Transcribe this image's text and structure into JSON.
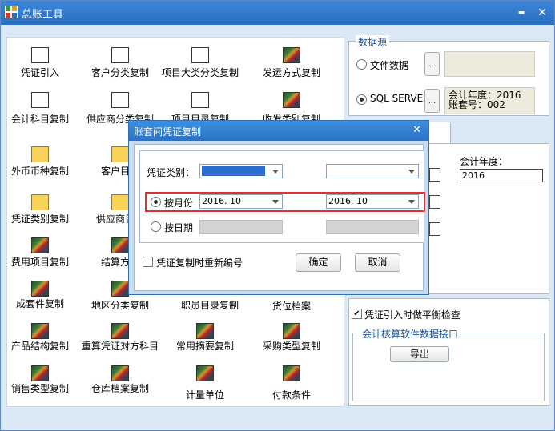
{
  "window": {
    "title": "总账工具",
    "min_glyph": "▬",
    "close_glyph": "✕"
  },
  "tools": [
    {
      "label": "凭证引入",
      "icon": "doc-icon"
    },
    {
      "label": "客户分类复制",
      "icon": "doc-icon"
    },
    {
      "label": "项目大类分类复制",
      "icon": "doc-icon"
    },
    {
      "label": "发运方式复制",
      "icon": "image-icon"
    },
    {
      "label": "会计科目复制",
      "icon": "doc-icon"
    },
    {
      "label": "供应商分类复制",
      "icon": "doc-icon"
    },
    {
      "label": "项目目录复制",
      "icon": "menu-icon"
    },
    {
      "label": "收发类别复制",
      "icon": "image-icon"
    },
    {
      "label": "外币币种复制",
      "icon": "folder-icon"
    },
    {
      "label": "客户目录",
      "icon": "folder-icon"
    },
    {
      "label": "凭证类别复制",
      "icon": "folder-icon"
    },
    {
      "label": "供应商目录",
      "icon": "folder-icon"
    },
    {
      "label": "费用项目复制",
      "icon": "image-icon"
    },
    {
      "label": "结算方式",
      "icon": "image-icon"
    },
    {
      "label": "成套件复制",
      "icon": "image-icon"
    },
    {
      "label": "地区分类复制",
      "icon": "image-icon"
    },
    {
      "label": "职员目录复制",
      "icon": "image-icon"
    },
    {
      "label": "货位档案",
      "icon": "image-icon"
    },
    {
      "label": "产品结构复制",
      "icon": "image-icon"
    },
    {
      "label": "重算凭证对方科目",
      "icon": "image-icon"
    },
    {
      "label": "常用摘要复制",
      "icon": "image-icon"
    },
    {
      "label": "采购类型复制",
      "icon": "image-icon"
    },
    {
      "label": "销售类型复制",
      "icon": "image-icon"
    },
    {
      "label": "仓库档案复制",
      "icon": "image-icon"
    },
    {
      "label": "计量单位",
      "icon": "image-icon"
    },
    {
      "label": "付款条件",
      "icon": "image-icon"
    }
  ],
  "datasource": {
    "title": "数据源",
    "file_label": "文件数据",
    "sql_label": "SQL SERVER",
    "browse": "...",
    "info_line1": "会计年度：2016",
    "info_line2": "账套号：002"
  },
  "year": {
    "label": "会计年度：",
    "value": "2016"
  },
  "balance_check": "凭证引入时做平衡检查",
  "interface": {
    "title": "会计核算软件数据接口",
    "export": "导出"
  },
  "dialog": {
    "title": "账套间凭证复制",
    "close": "✕",
    "type_label": "凭证类别：",
    "by_month": "按月份",
    "month_from": "2016. 10",
    "month_to": "2016. 10",
    "by_date": "按日期",
    "renumber": "凭证复制时重新编号",
    "ok": "确定",
    "cancel": "取消"
  }
}
